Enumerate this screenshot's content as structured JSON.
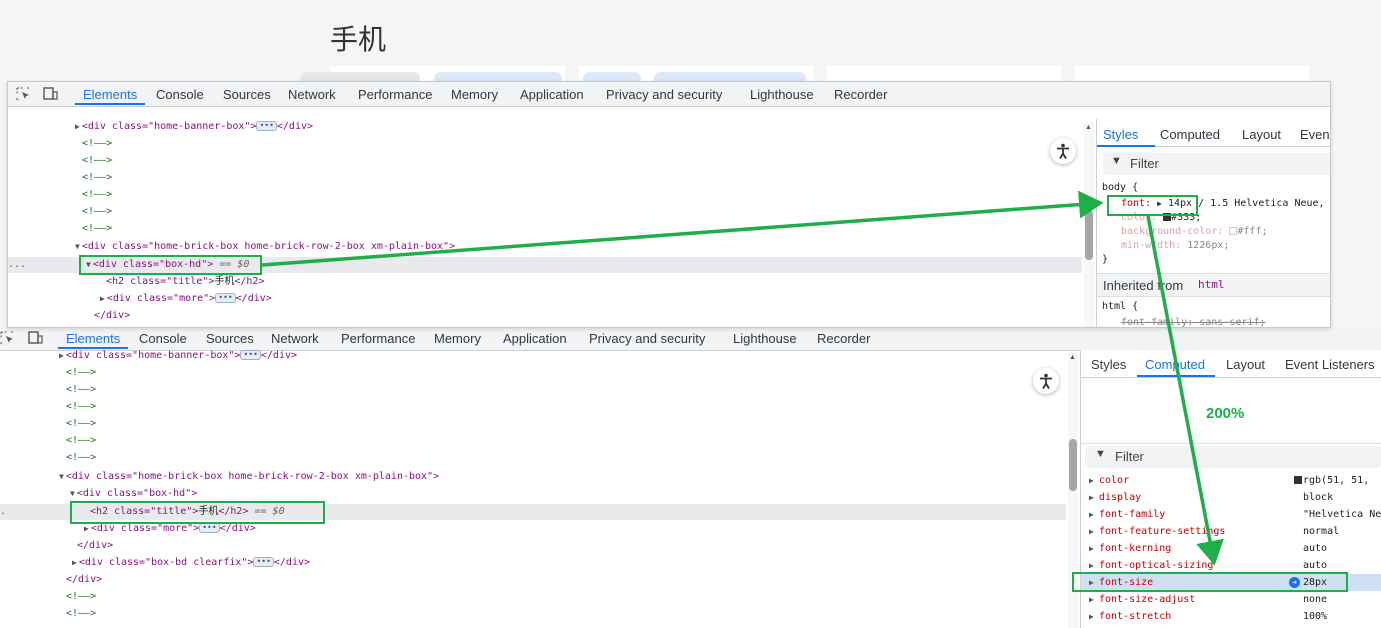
{
  "page": {
    "title": "手机"
  },
  "colors": {
    "accent": "#1a73e8",
    "highlight": "#1fae4a"
  },
  "annotation": {
    "zoom_label": "200%"
  },
  "devtools_top": {
    "tabs": [
      "Elements",
      "Console",
      "Sources",
      "Network",
      "Performance",
      "Memory",
      "Application",
      "Privacy and security",
      "Lighthouse",
      "Recorder"
    ],
    "active_tab": "Elements",
    "icons": [
      "inspect-icon",
      "device-toggle-icon"
    ],
    "tree": {
      "banner": {
        "open": "<div class=\"home-banner-box\">",
        "close": "</div>"
      },
      "comment": "<!——>",
      "brick": "<div class=\"home-brick-box home-brick-row-2-box xm-plain-box\">",
      "box_hd": "<div class=\"box-hd\">",
      "selected_suffix": "== $0",
      "title_line": {
        "open": "<h2 class=\"title\">",
        "text": "手机",
        "close": "</h2>"
      },
      "more": {
        "open": "<div class=\"more\">",
        "close": "</div>"
      },
      "close_div": "</div>",
      "row_menu": "..."
    },
    "styles": {
      "tabs": [
        "Styles",
        "Computed",
        "Layout",
        "Event"
      ],
      "active_tab": "Styles",
      "filter": "Filter",
      "selector": "body {",
      "font_prop": "font:",
      "font_value": "14px",
      "font_rest": "/ 1.5 Helvetica Neue, I",
      "color_prop": "color:",
      "color_value": "#333;",
      "bg_prop": "background-color:",
      "bg_value": "#fff;",
      "minw_prop": "min-width:",
      "minw_value": "1226px;",
      "close": "}",
      "inherited_label": "Inherited from",
      "inherited_tag": "html",
      "html_selector": "html {",
      "html_font_family": "font-family: sans-serif;"
    }
  },
  "devtools_bottom": {
    "tabs": [
      "Elements",
      "Console",
      "Sources",
      "Network",
      "Performance",
      "Memory",
      "Application",
      "Privacy and security",
      "Lighthouse",
      "Recorder"
    ],
    "active_tab": "Elements",
    "tree": {
      "banner": {
        "open": "<div class=\"home-banner-box\">",
        "close": "</div>"
      },
      "comment": "<!——>",
      "brick": "<div class=\"home-brick-box home-brick-row-2-box xm-plain-box\">",
      "box_hd": "<div class=\"box-hd\">",
      "title_line": {
        "open": "<h2 class=\"title\">",
        "text": "手机",
        "close": "</h2>"
      },
      "selected_suffix": "== $0",
      "more": {
        "open": "<div class=\"more\">",
        "close": "</div>"
      },
      "close_div": "</div>",
      "box_bd": {
        "open": "<div class=\"box-bd clearfix\">",
        "close": "</div>"
      },
      "row_menu": "."
    },
    "side": {
      "tabs": [
        "Styles",
        "Computed",
        "Layout",
        "Event Listeners"
      ],
      "active_tab": "Computed",
      "filter": "Filter",
      "rows": [
        {
          "prop": "color",
          "value": "rgb(51, 51,",
          "swatch": "#333333"
        },
        {
          "prop": "display",
          "value": "block"
        },
        {
          "prop": "font-family",
          "value": "\"Helvetica Ne"
        },
        {
          "prop": "font-feature-settings",
          "value": "normal"
        },
        {
          "prop": "font-kerning",
          "value": "auto"
        },
        {
          "prop": "font-optical-sizing",
          "value": "auto"
        },
        {
          "prop": "font-size",
          "value": "28px",
          "highlighted": true
        },
        {
          "prop": "font-size-adjust",
          "value": "none"
        },
        {
          "prop": "font-stretch",
          "value": "100%"
        }
      ]
    }
  }
}
